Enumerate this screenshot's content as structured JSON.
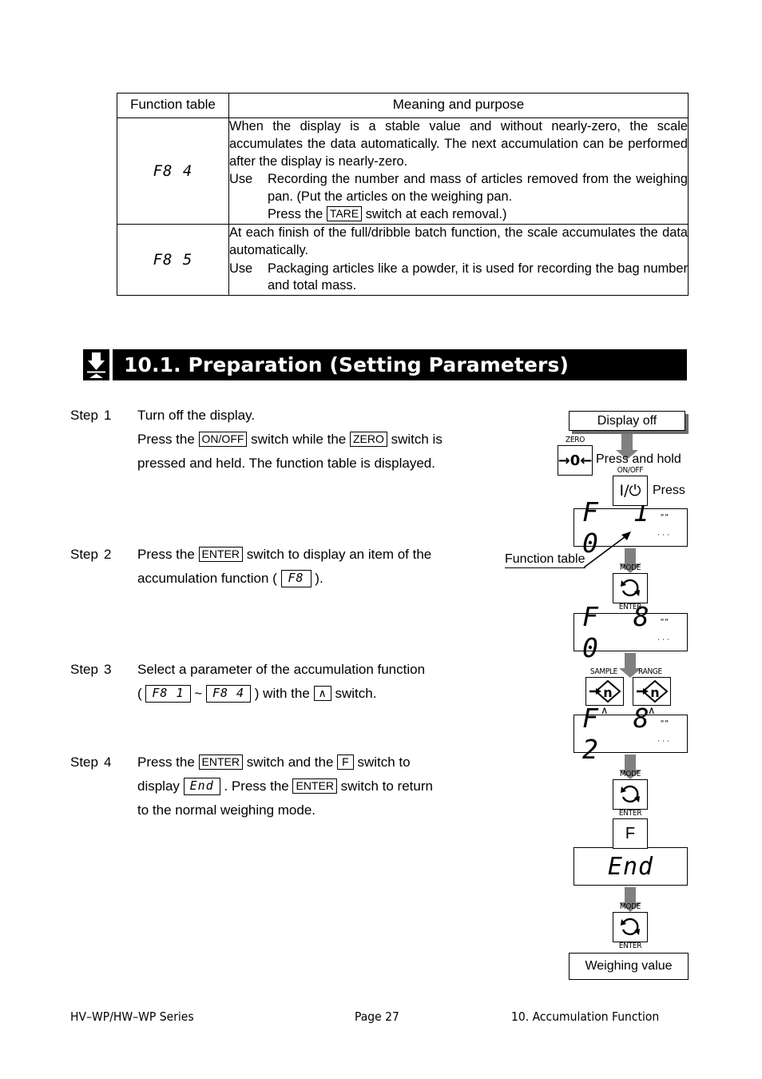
{
  "function_table": {
    "headers": [
      "Function table",
      "Meaning and purpose"
    ],
    "rows": [
      {
        "code": "F8 4",
        "paragraph": "When the display is a stable value and without nearly-zero, the scale accumulates the data automatically. The next accumulation can be performed after the display is nearly-zero.",
        "use_label": "Use",
        "use_text_1": "Recording the number and mass of articles removed from the weighing pan. (Put the articles on the weighing pan.",
        "use_text_2_before": "Press the",
        "use_key": "TARE",
        "use_text_2_after": "switch at each removal.)"
      },
      {
        "code": "F8 5",
        "paragraph": "At each finish of the full/dribble batch function, the scale accumulates the data automatically.",
        "use_label": "Use",
        "use_text_1": "Packaging articles like a powder, it is used for recording the bag number and total mass."
      }
    ]
  },
  "section": {
    "number": "10.1.",
    "title": "10.1.  Preparation (Setting Parameters)",
    "icon": "down-arrow-to-line-icon",
    "bar_color": "#000000"
  },
  "steps": [
    {
      "label": "Step",
      "number": "1",
      "line1": "Turn off the display.",
      "line2_a": "Press the",
      "line2_key1": "ON/OFF",
      "line2_b": "switch while the",
      "line2_key2": "ZERO",
      "line2_c": "switch is",
      "line3": "pressed and held. The function table is displayed."
    },
    {
      "label": "Step",
      "number": "2",
      "line1_a": "Press the",
      "line1_key1": "ENTER",
      "line1_b": "switch to display an item of the",
      "line2_a": "accumulation function (",
      "line2_seg": "F8",
      "line2_b": ")."
    },
    {
      "label": "Step",
      "number": "3",
      "line1": "Select a parameter of the accumulation function",
      "line2_a": "(",
      "line2_seg1": "F8  1",
      "line2_tilde": "~",
      "line2_seg2": "F8  4",
      "line2_b": ") with the",
      "line2_key": "∧",
      "line2_c": "switch."
    },
    {
      "label": "Step",
      "number": "4",
      "line1_a": "Press the",
      "line1_key1": "ENTER",
      "line1_b": "switch and the",
      "line1_key2": "F",
      "line1_c": "switch to",
      "line2_a": "display",
      "line2_seg": "End",
      "line2_b": ". Press the",
      "line2_key": "ENTER",
      "line2_c": "switch to return",
      "line3": "to the normal weighing mode."
    }
  ],
  "flow": {
    "display_off": "Display off",
    "press_and_hold": "Press and hold",
    "press": "Press",
    "zero_cap": "ZERO",
    "zero_glyph": "→0←",
    "onoff_cap": "ON/OFF",
    "onoff_glyph": "I/⏻",
    "function_table_callout": "Function table",
    "lcd_1": "F 1 0",
    "lcd_2": "F 8 0",
    "lcd_3": "F 8 2",
    "lcd_4": "End",
    "mode_cap": "MODE",
    "enter_cap": "ENTER",
    "mode_glyph": "circular-arrows-icon",
    "sample_cap": "SAMPLE",
    "range_cap": "RANGE",
    "sample_glyph": "→n",
    "range_glyph": "→n",
    "caret": "∧",
    "f_key": "F",
    "weighing_value": "Weighing value",
    "blink_top": "\"\"",
    "blink_bottom": "˙˙˙"
  },
  "footer": {
    "left": "HV–WP/HW–WP Series",
    "middle": "Page 27",
    "right": "10. Accumulation Function"
  }
}
